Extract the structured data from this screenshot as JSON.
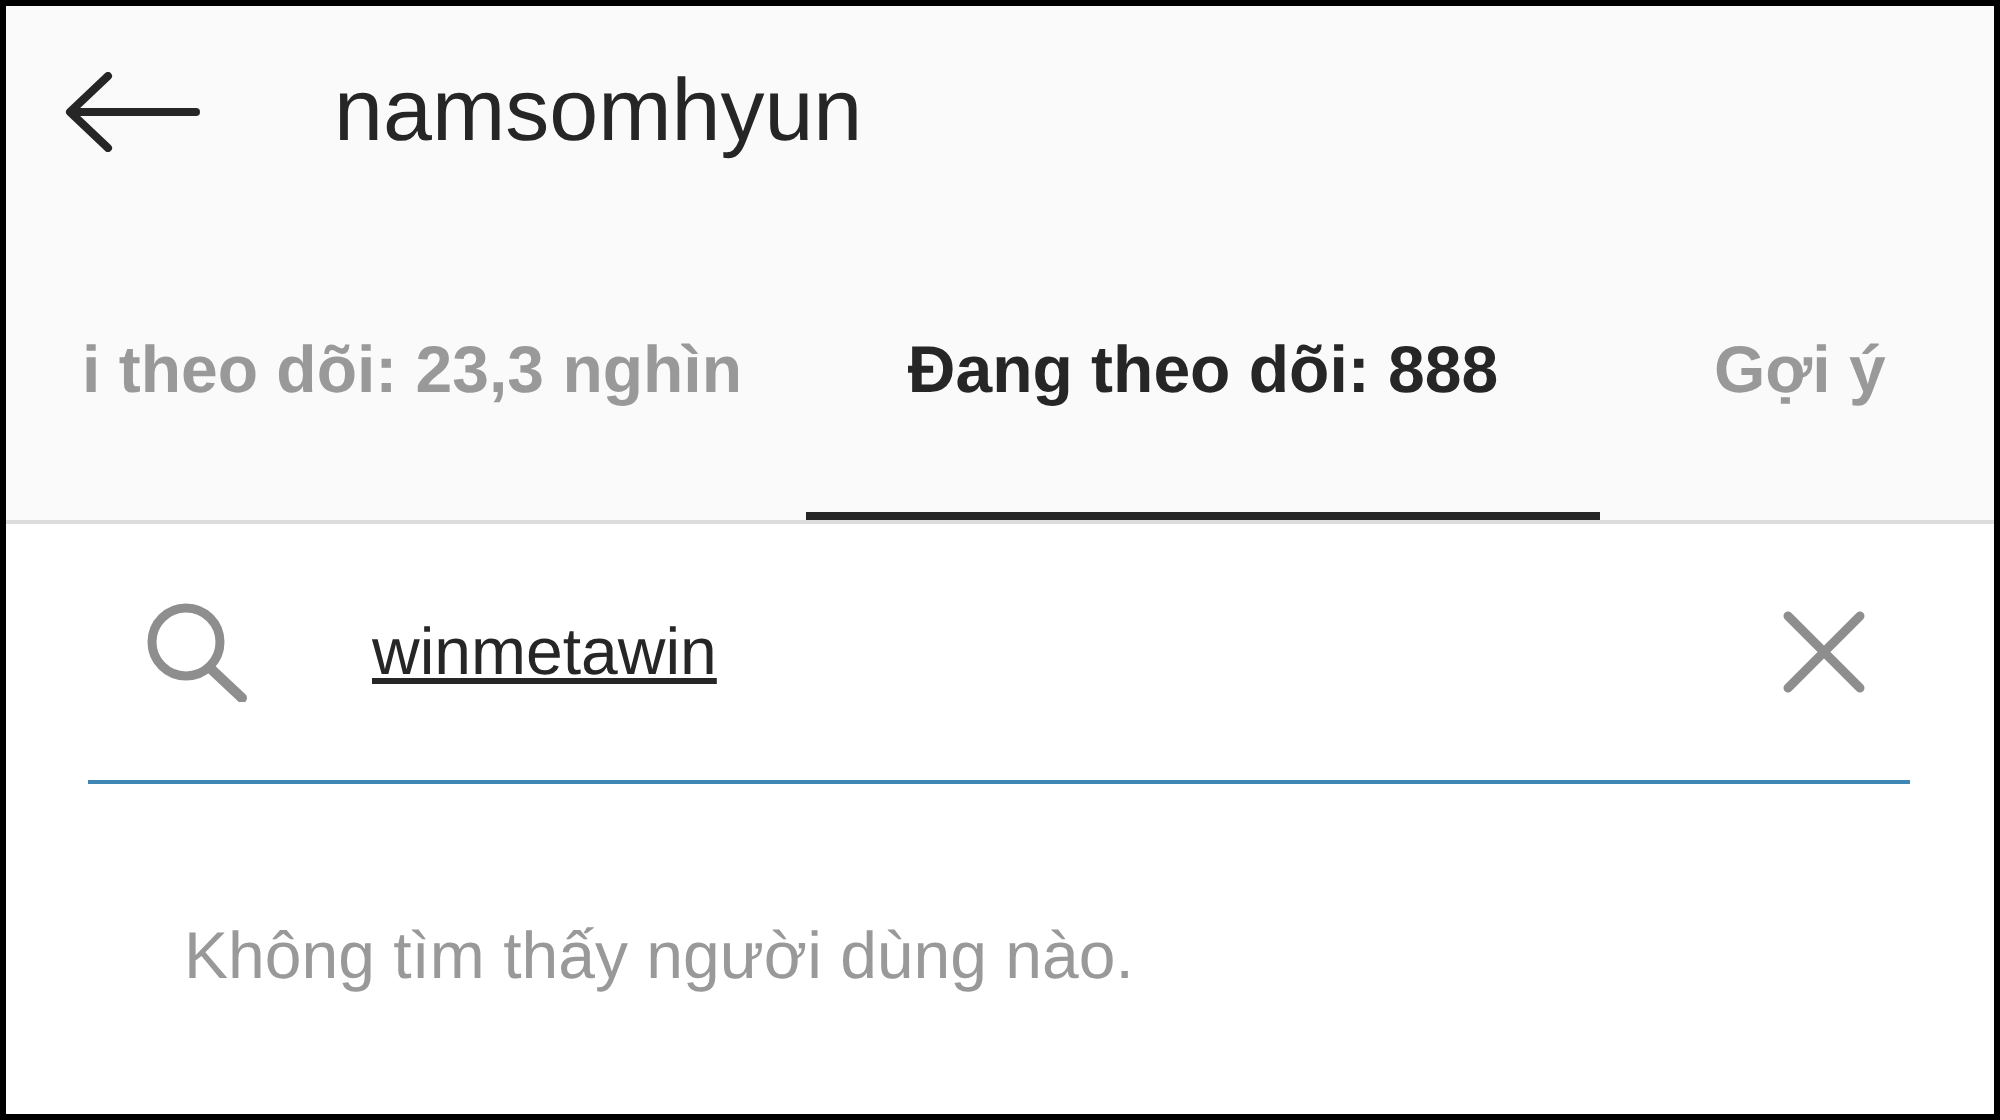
{
  "header": {
    "title": "namsomhyun"
  },
  "tabs": [
    {
      "label": "i theo dõi: 23,3 nghìn",
      "selected": false
    },
    {
      "label": "Đang theo dõi: 888",
      "selected": true
    },
    {
      "label": "Gợi ý",
      "selected": false
    }
  ],
  "search": {
    "value": "winmetawin"
  },
  "message": "Không tìm thấy người dùng nào."
}
